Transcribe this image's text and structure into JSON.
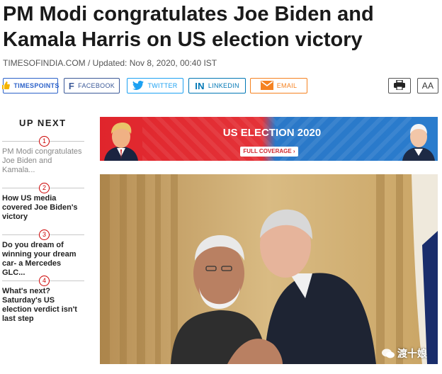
{
  "article": {
    "headline": "PM Modi congratulates Joe Biden and Kamala Harris on US election victory",
    "source": "TIMESOFINDIA.COM",
    "updated": " / Updated: Nov 8, 2020, 00:40 IST"
  },
  "share": {
    "timespoints": "TIMESPOINTS",
    "facebook": "FACEBOOK",
    "twitter": "TWITTER",
    "linkedin": "LINKEDIN",
    "email": "EMAIL",
    "font_size": "AA"
  },
  "up_next": {
    "title": "UP NEXT",
    "items": [
      {
        "num": "1",
        "text": "PM Modi congratulates Joe Biden and Kamala..."
      },
      {
        "num": "2",
        "text": "How US media covered Joe Biden's victory"
      },
      {
        "num": "3",
        "text": "Do you dream of winning your dream car- a Mercedes GLC..."
      },
      {
        "num": "4",
        "text": "What's next? Saturday's US election verdict isn't last step"
      }
    ]
  },
  "banner": {
    "title": "US ELECTION 2020",
    "button": "FULL COVERAGE ›"
  },
  "watermark": {
    "text": "渡十娘"
  },
  "colors": {
    "accent_red": "#e0252c",
    "accent_blue": "#2a78c8",
    "timespoints": "#2c62c9",
    "facebook": "#3b5998",
    "twitter": "#1da1f2",
    "linkedin": "#0077b5",
    "email": "#f58220"
  },
  "icons": {
    "timespoints": "thumbs-up-icon",
    "facebook": "facebook-icon",
    "twitter": "twitter-bird-icon",
    "linkedin": "linkedin-icon",
    "email": "envelope-icon",
    "print": "printer-icon",
    "font": "font-size-icon",
    "watermark": "wechat-icon"
  }
}
